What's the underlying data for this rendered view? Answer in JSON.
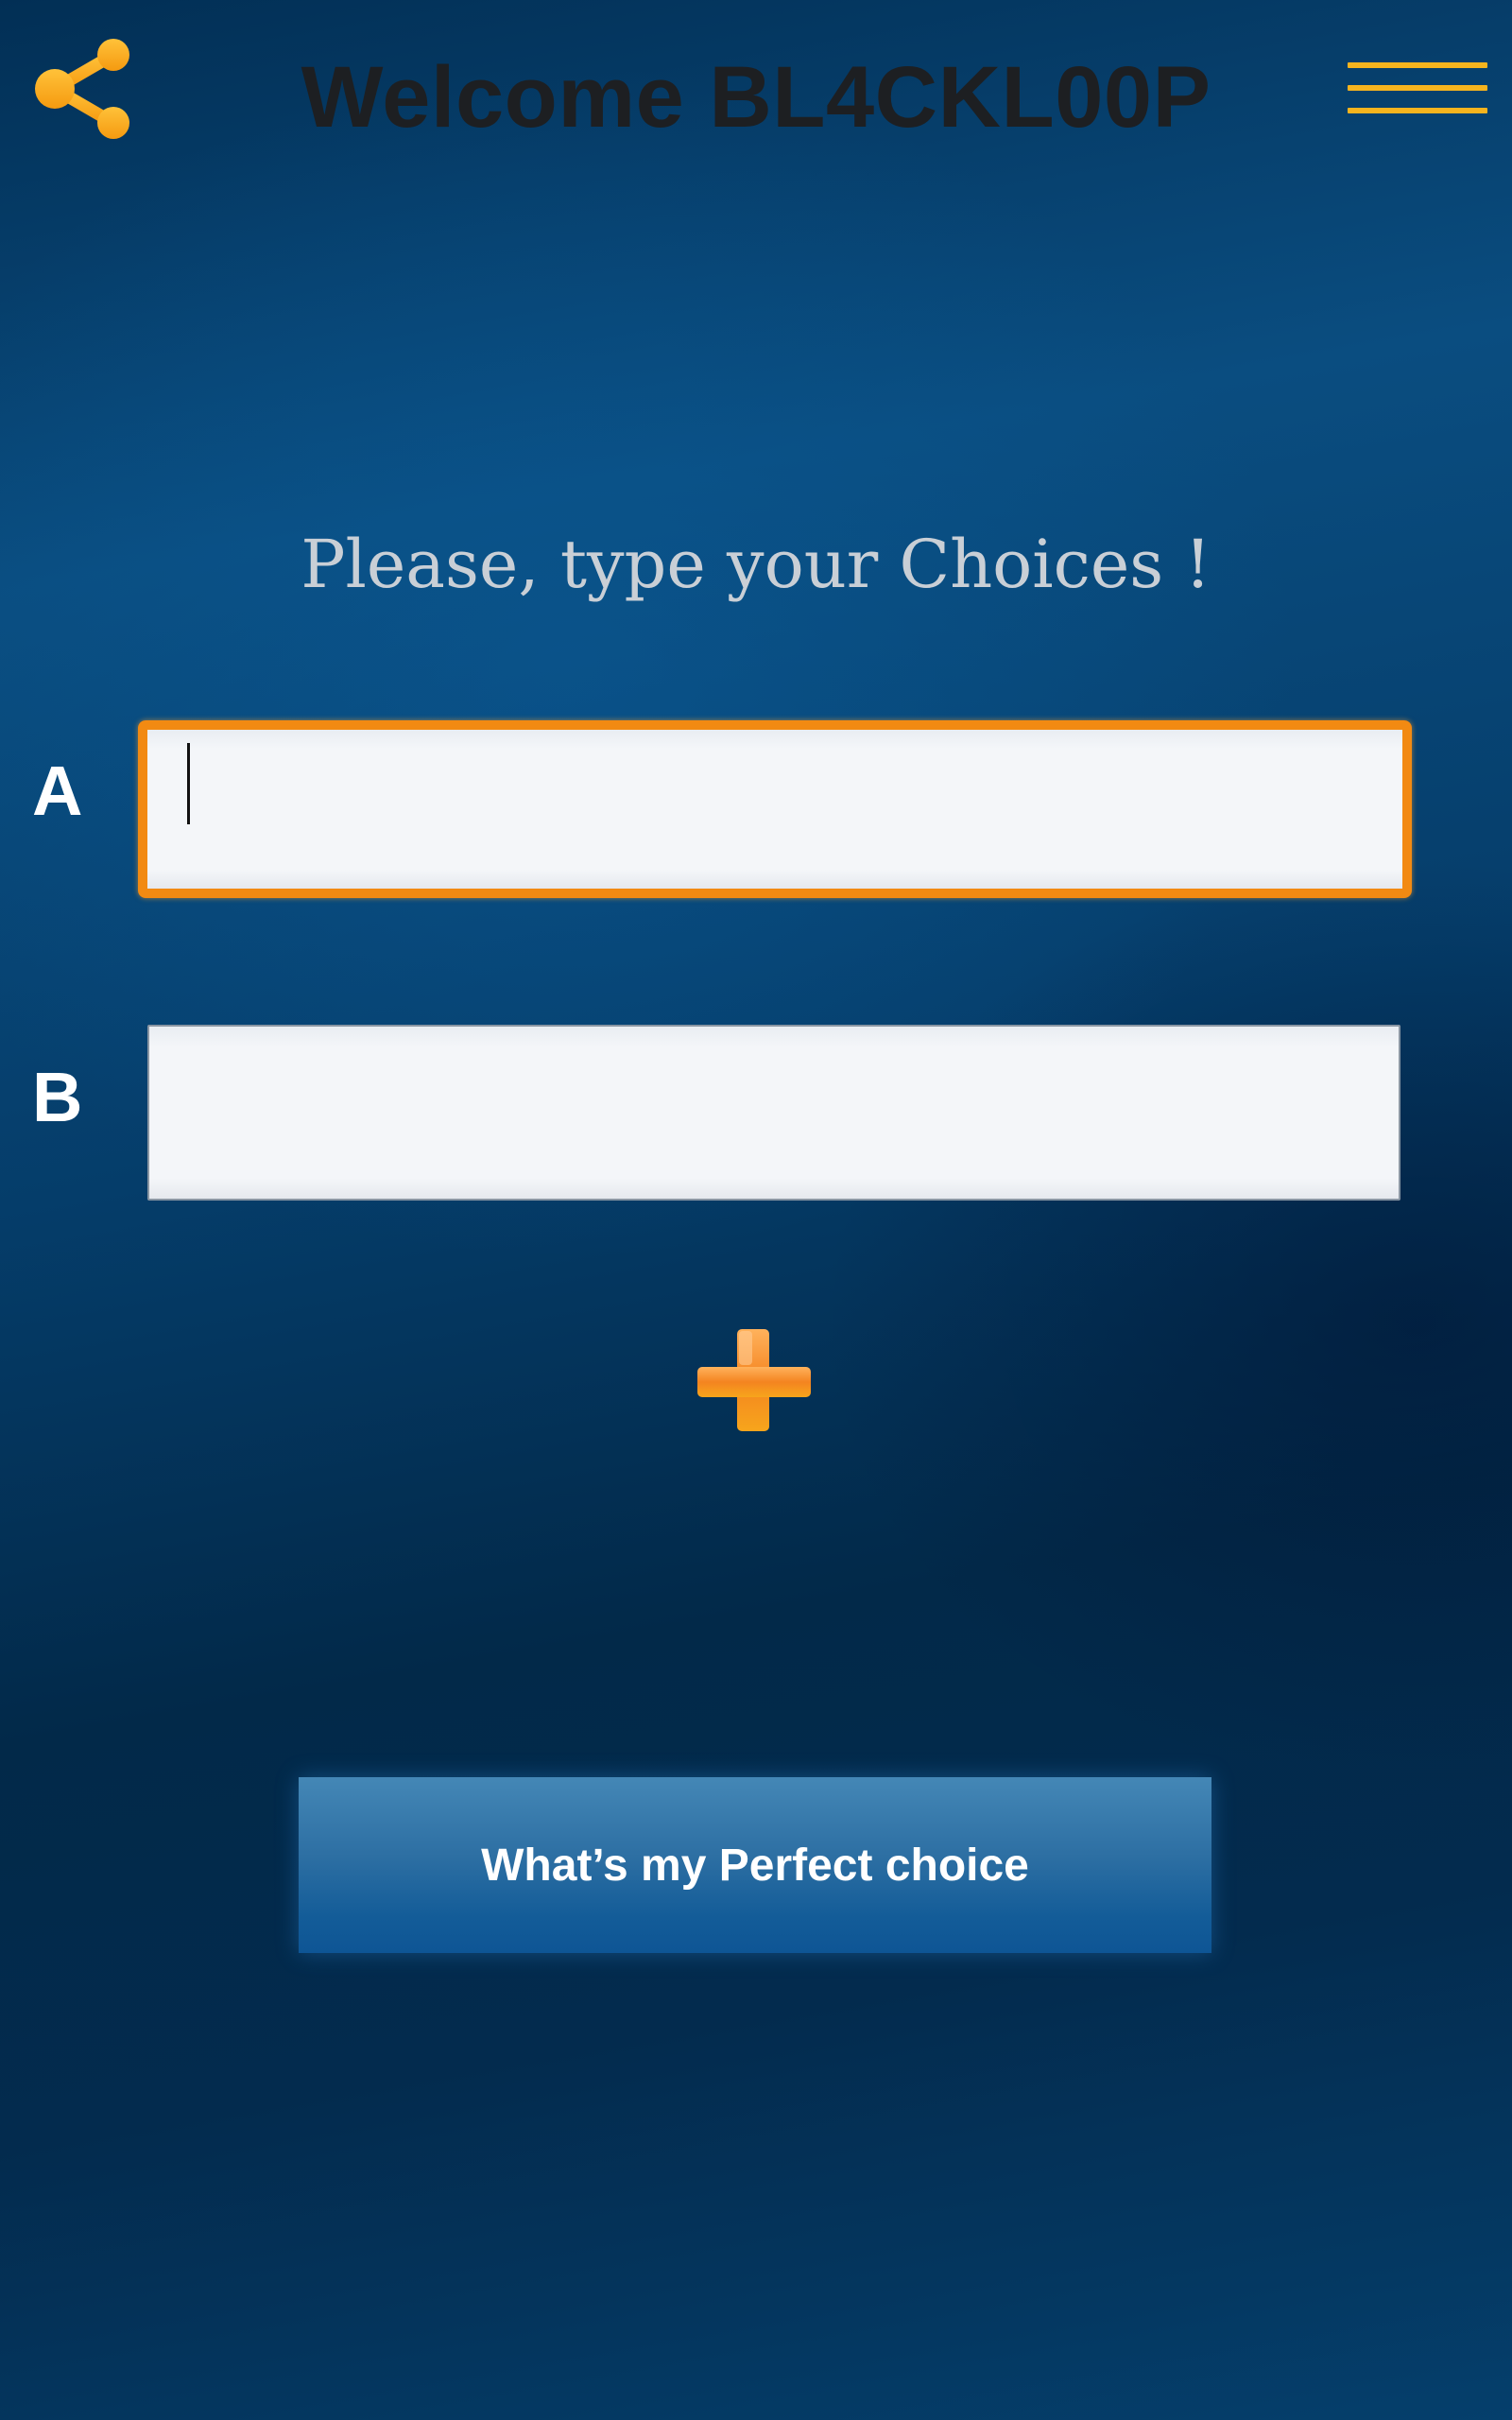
{
  "header": {
    "title": "Welcome BL4CKL00P",
    "share_icon": "share-icon",
    "menu_icon": "hamburger-menu-icon"
  },
  "main": {
    "prompt": "Please, type your Choices !",
    "choices": [
      {
        "label": "A",
        "value": "",
        "focused": true
      },
      {
        "label": "B",
        "value": "",
        "focused": false
      }
    ],
    "add_icon": "plus-icon",
    "submit_label": "What’s my Perfect choice"
  },
  "colors": {
    "accent": "#f28a12",
    "menu_lines": "#f6b41e",
    "title_text": "#1d1f22",
    "prompt_text": "#c9cfd6",
    "button": "#1a609b",
    "background": "#053d6a"
  }
}
